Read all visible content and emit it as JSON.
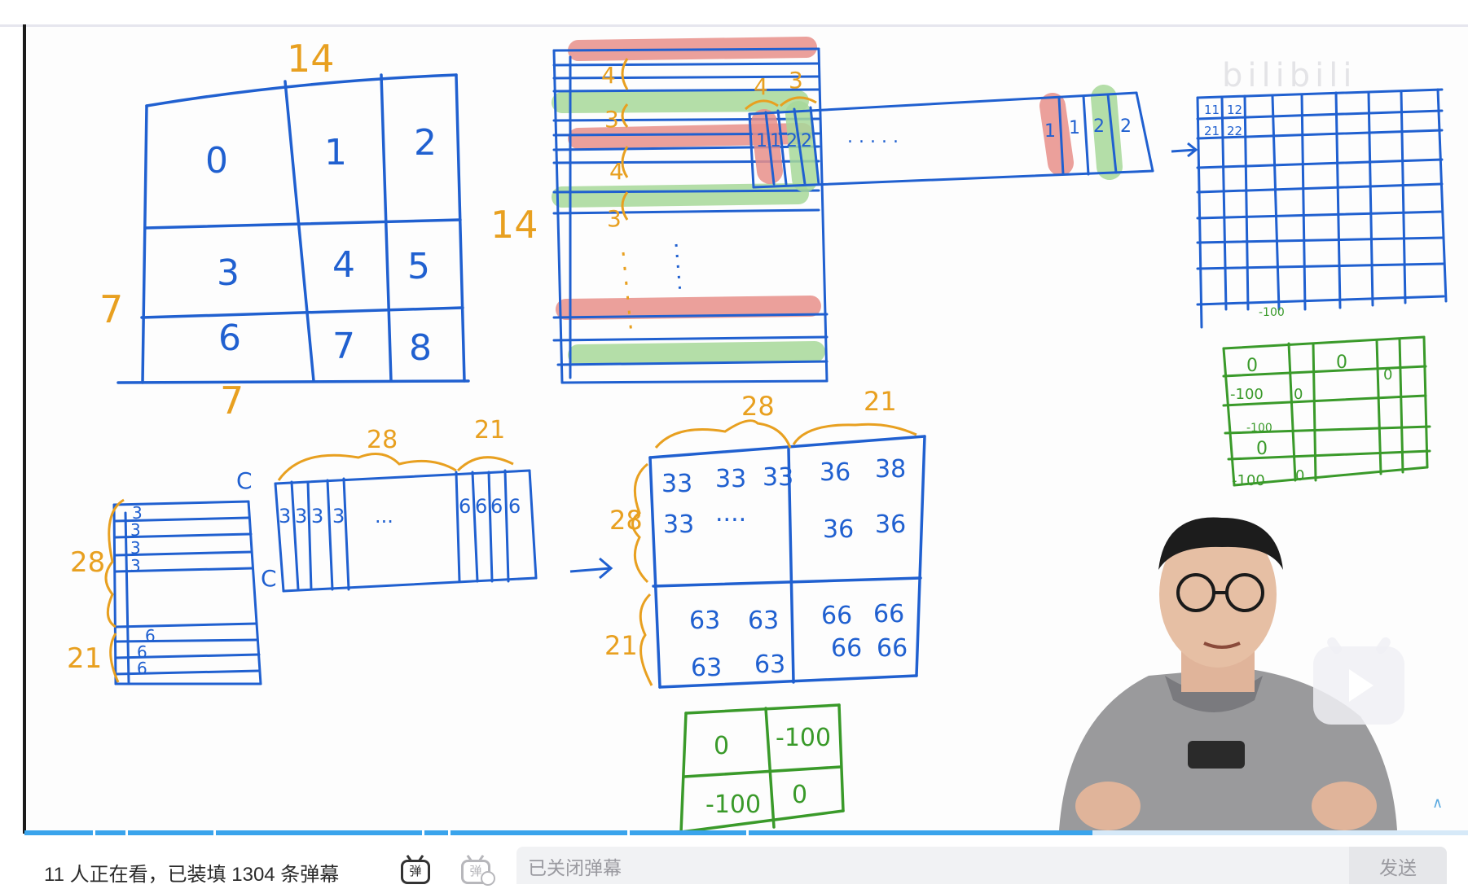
{
  "player": {
    "progress_fraction": 0.74,
    "watermark": "bilibili"
  },
  "bottom_bar": {
    "viewers_text": "11 人正在看，已装填 1304 条弹幕",
    "danmaku_toggle_on_glyph": "弹",
    "danmaku_toggle_off_glyph": "弹",
    "danmaku_input_placeholder": "已关闭弹幕",
    "send_label": "发送"
  },
  "whiteboard": {
    "grid_top_label": "14",
    "grid_right_label": "14",
    "grid_left_label": "7",
    "grid_bottom_label": "7",
    "grid_cells": [
      "0",
      "1",
      "2",
      "3",
      "4",
      "5",
      "6",
      "7",
      "8"
    ],
    "stack_labels": [
      "4",
      "3",
      "4",
      "3"
    ],
    "row_strip_labels": [
      "4",
      "3"
    ],
    "strip_cells": [
      "1",
      "1",
      "2",
      "2",
      ". . . . .",
      "1",
      "1",
      "2",
      "2"
    ],
    "tall_strip_labels": [
      "28",
      "21",
      "C"
    ],
    "tall_strip_rows": [
      "3",
      "3",
      "3",
      "3",
      "6",
      "6",
      "6"
    ],
    "wide_strip_labels": [
      "28",
      "21",
      "C"
    ],
    "wide_strip_cells": [
      "3",
      "3",
      "3",
      "3",
      "...",
      "6",
      "6",
      "6",
      "6"
    ],
    "block_top_labels": [
      "28",
      "21"
    ],
    "block_left_labels": [
      "28",
      "21"
    ],
    "block_values": [
      "33",
      "33",
      "33",
      "36",
      "38",
      "33",
      "....",
      "36",
      "36",
      "63",
      "63",
      "66",
      "66",
      "63",
      "63",
      "66",
      "66"
    ],
    "mask_small": [
      "0",
      "-100",
      "-100",
      "0"
    ],
    "mask_green": [
      "-100",
      "0",
      "0",
      "0",
      "-100",
      "0",
      "-100",
      "0",
      "-100",
      "0"
    ],
    "small_grid_cells": [
      "11",
      "12",
      "21",
      "22"
    ],
    "colors": {
      "ink_blue": "#2060d0",
      "ink_orange": "#e8a020",
      "ink_green": "#3a9a2a",
      "highlight_red": "#e9908a",
      "highlight_green": "#a8d99a"
    }
  }
}
